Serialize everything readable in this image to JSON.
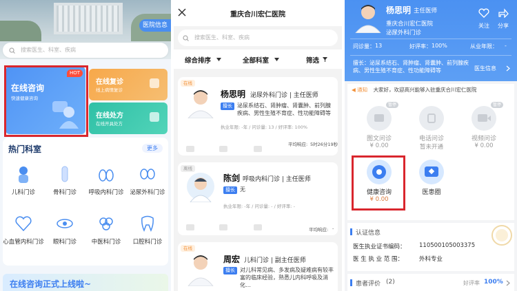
{
  "app1": {
    "hospital_info_btn": "医院信息",
    "search_placeholder": "搜索医生、科室、疾病",
    "online_consult": {
      "title": "在线咨询",
      "subtitle": "快速健康咨询",
      "badge": "HOT"
    },
    "revisit": {
      "title": "在线复诊",
      "subtitle": "线上病情复诊"
    },
    "prescription": {
      "title": "在线处方",
      "subtitle": "在线开具处方"
    },
    "hot_depts_title": "热门科室",
    "more": "更多",
    "depts": [
      {
        "label": "儿科门诊",
        "icon": "child-icon"
      },
      {
        "label": "骨科门诊",
        "icon": "bone-icon"
      },
      {
        "label": "呼吸内科门诊",
        "icon": "lungs-icon"
      },
      {
        "label": "泌尿外科门诊",
        "icon": "kidney-icon"
      },
      {
        "label": "心血管内科门诊",
        "icon": "heart-icon"
      },
      {
        "label": "眼科门诊",
        "icon": "eye-icon"
      },
      {
        "label": "中医科门诊",
        "icon": "herb-icon"
      },
      {
        "label": "口腔科门诊",
        "icon": "tooth-icon"
      }
    ],
    "banner_text": "在线咨询正式上线啦~"
  },
  "app2": {
    "title": "重庆合川宏仁医院",
    "search_placeholder": "搜索医生、科室、疾病",
    "filters": {
      "sort": "综合排序",
      "dept": "全部科室",
      "filter": "筛选"
    },
    "doctors": [
      {
        "status": "在线",
        "name": "杨思明",
        "dept": "泌尿外科门诊 | 主任医师",
        "skill_label": "擅长",
        "skill": "泌尿系结石、肾肿瘤、肾囊肿、前列腺疾病、男性生殖不育症、性功能障碍等",
        "meta": "执业年限: -年 / 问诊量: 13 / 好评率: 100%",
        "resp_label": "平均响应:",
        "resp_value": "5时26分19秒"
      },
      {
        "status": "离线",
        "name": "陈剑",
        "dept": "呼吸内科门诊 | 主任医师",
        "skill_label": "擅长",
        "skill": "无",
        "meta": "执业年限: -年 / 问诊量: - / 好评率: -",
        "resp_label": "平均响应:",
        "resp_value": "-"
      },
      {
        "status": "在线",
        "name": "周宏",
        "dept": "儿科门诊 | 副主任医师",
        "skill_label": "擅长",
        "skill": "对儿科常见病、多发病及疑难病有较丰富的临床经验，熟悉儿内科呼吸及消化…",
        "meta": "",
        "resp_label": "",
        "resp_value": ""
      }
    ]
  },
  "app3": {
    "doctor_name": "杨思明",
    "doctor_title": "主任医师",
    "hospital": "重庆合川宏仁医院",
    "dept": "泌尿外科门诊",
    "follow": "关注",
    "share": "分享",
    "stats": {
      "consult_label": "问诊量：",
      "consult_value": "13",
      "rating_label": "好评率：",
      "rating_value": "100%",
      "years_label": "从业年限：",
      "years_value": "-"
    },
    "skill_label": "擅长：",
    "skill": "泌尿系结石、肾肿瘤、肾囊肿、前列腺疾病、男性生殖不育症、性功能障碍等",
    "intro": "医生信息",
    "notice_label": "通知",
    "notice": "大家好，欢迎高兴能够入驻重庆合川宏仁医院",
    "services": [
      {
        "name": "图文问诊",
        "price": "¥ 0.00",
        "badge": "暂停",
        "state": "gray"
      },
      {
        "name": "电话问诊",
        "price": "暂未开通",
        "badge": "",
        "state": "gray"
      },
      {
        "name": "视频问诊",
        "price": "¥ 0.00",
        "badge": "暂停",
        "state": "gray"
      },
      {
        "name": "健康咨询",
        "price": "¥ 0.00",
        "badge": "",
        "state": "active"
      },
      {
        "name": "医患圈",
        "price": "",
        "badge": "",
        "state": "active"
      }
    ],
    "cert_title": "认证信息",
    "cert_no_label": "医生执业证书编码：",
    "cert_no": "110500105003375",
    "cert_scope_label": "医 生 执 业 范 围：",
    "cert_scope": "外科专业",
    "review_label": "患者评价",
    "review_count": "(2)",
    "review_rate_label": "好评率",
    "review_rate": "100%"
  },
  "colors": {
    "primary": "#3c7ef0",
    "highlight": "#d9262d",
    "orange": "#f7a84a",
    "teal": "#2fc0a6"
  }
}
